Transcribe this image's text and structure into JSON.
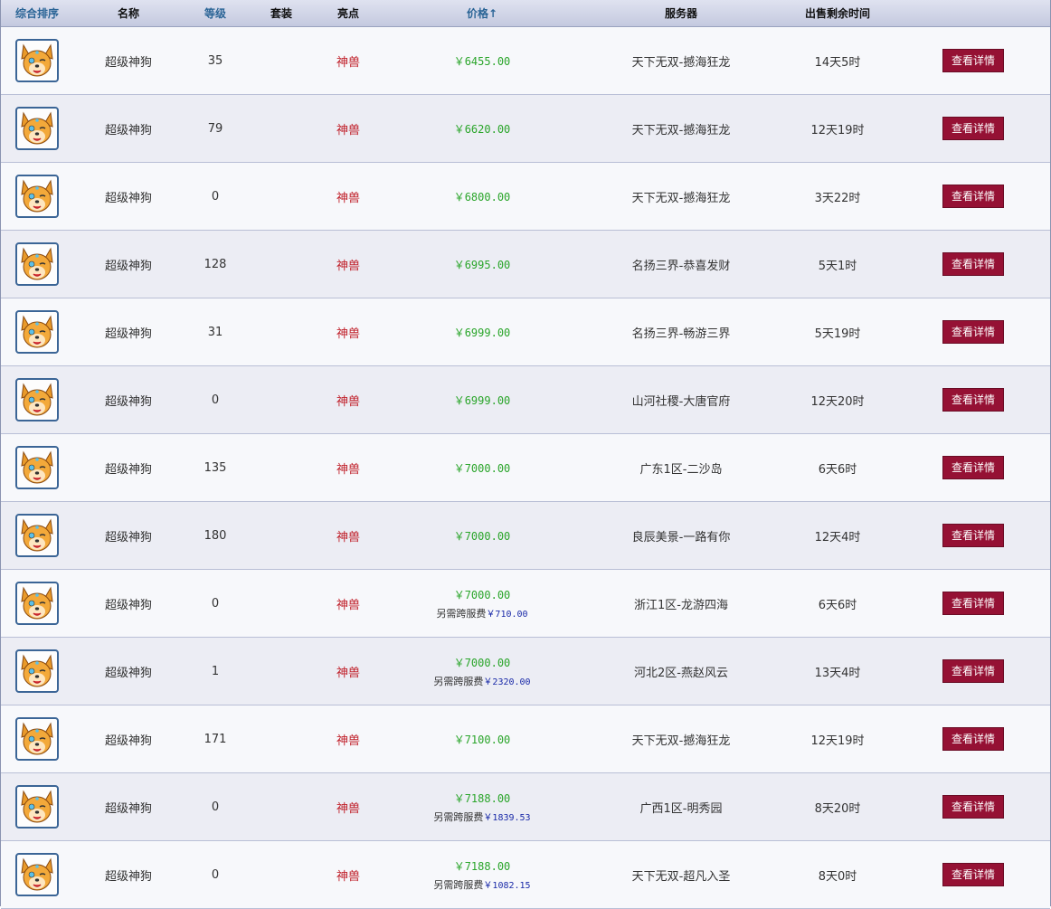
{
  "header": {
    "sort_label": "综合排序",
    "name_label": "名称",
    "level_label": "等级",
    "suit_label": "套装",
    "feature_label": "亮点",
    "price_label": "价格",
    "price_sort_icon": "↑",
    "server_label": "服务器",
    "time_label": "出售剩余时间"
  },
  "colors": {
    "price": "#2aa52a",
    "feature": "#c0202a",
    "fee": "#1a2aa8",
    "button": "#951134",
    "header_link": "#2a6496"
  },
  "extra_fee_label": "另需跨服费",
  "items": [
    {
      "name": "超级神狗",
      "level": "35",
      "feature": "神兽",
      "price": "￥6455.00",
      "fee": "",
      "server": "天下无双-撼海狂龙",
      "time": "14天5时",
      "button": "查看详情"
    },
    {
      "name": "超级神狗",
      "level": "79",
      "feature": "神兽",
      "price": "￥6620.00",
      "fee": "",
      "server": "天下无双-撼海狂龙",
      "time": "12天19时",
      "button": "查看详情"
    },
    {
      "name": "超级神狗",
      "level": "0",
      "feature": "神兽",
      "price": "￥6800.00",
      "fee": "",
      "server": "天下无双-撼海狂龙",
      "time": "3天22时",
      "button": "查看详情"
    },
    {
      "name": "超级神狗",
      "level": "128",
      "feature": "神兽",
      "price": "￥6995.00",
      "fee": "",
      "server": "名扬三界-恭喜发财",
      "time": "5天1时",
      "button": "查看详情"
    },
    {
      "name": "超级神狗",
      "level": "31",
      "feature": "神兽",
      "price": "￥6999.00",
      "fee": "",
      "server": "名扬三界-畅游三界",
      "time": "5天19时",
      "button": "查看详情"
    },
    {
      "name": "超级神狗",
      "level": "0",
      "feature": "神兽",
      "price": "￥6999.00",
      "fee": "",
      "server": "山河社稷-大唐官府",
      "time": "12天20时",
      "button": "查看详情"
    },
    {
      "name": "超级神狗",
      "level": "135",
      "feature": "神兽",
      "price": "￥7000.00",
      "fee": "",
      "server": "广东1区-二沙岛",
      "time": "6天6时",
      "button": "查看详情"
    },
    {
      "name": "超级神狗",
      "level": "180",
      "feature": "神兽",
      "price": "￥7000.00",
      "fee": "",
      "server": "良辰美景-一路有你",
      "time": "12天4时",
      "button": "查看详情"
    },
    {
      "name": "超级神狗",
      "level": "0",
      "feature": "神兽",
      "price": "￥7000.00",
      "fee": "￥710.00",
      "server": "浙江1区-龙游四海",
      "time": "6天6时",
      "button": "查看详情"
    },
    {
      "name": "超级神狗",
      "level": "1",
      "feature": "神兽",
      "price": "￥7000.00",
      "fee": "￥2320.00",
      "server": "河北2区-燕赵风云",
      "time": "13天4时",
      "button": "查看详情"
    },
    {
      "name": "超级神狗",
      "level": "171",
      "feature": "神兽",
      "price": "￥7100.00",
      "fee": "",
      "server": "天下无双-撼海狂龙",
      "time": "12天19时",
      "button": "查看详情"
    },
    {
      "name": "超级神狗",
      "level": "0",
      "feature": "神兽",
      "price": "￥7188.00",
      "fee": "￥1839.53",
      "server": "广西1区-明秀园",
      "time": "8天20时",
      "button": "查看详情"
    },
    {
      "name": "超级神狗",
      "level": "0",
      "feature": "神兽",
      "price": "￥7188.00",
      "fee": "￥1082.15",
      "server": "天下无双-超凡入圣",
      "time": "8天0时",
      "button": "查看详情"
    }
  ]
}
